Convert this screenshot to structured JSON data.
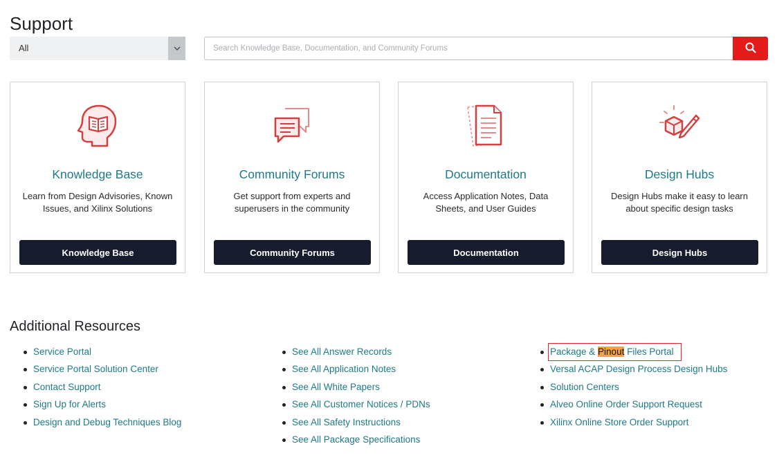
{
  "page": {
    "title": "Support"
  },
  "search": {
    "filter_value": "All",
    "placeholder": "Search Knowledge Base, Documentation, and Community Forums"
  },
  "cards": [
    {
      "icon": "head-book-icon",
      "title": "Knowledge Base",
      "description": "Learn from Design Advisories, Known Issues, and Xilinx Solutions",
      "button": "Knowledge Base"
    },
    {
      "icon": "chat-bubbles-icon",
      "title": "Community Forums",
      "description": "Get support from experts and superusers in the community",
      "button": "Community Forums"
    },
    {
      "icon": "document-icon",
      "title": "Documentation",
      "description": "Access Application Notes, Data Sheets, and User Guides",
      "button": "Documentation"
    },
    {
      "icon": "cube-pencil-icon",
      "title": "Design Hubs",
      "description": "Design Hubs make it easy to learn about specific design tasks",
      "button": "Design Hubs"
    }
  ],
  "additional_resources": {
    "title": "Additional Resources",
    "col1": [
      "Service Portal",
      "Service Portal Solution Center",
      "Contact Support",
      "Sign Up for Alerts",
      "Design and Debug Techniques Blog"
    ],
    "col2": [
      "See All Answer Records",
      "See All Application Notes",
      "See All White Papers",
      "See All Customer Notices / PDNs",
      "See All Safety Instructions",
      "See All Package Specifications"
    ],
    "col3_highlighted": {
      "before": "Package & ",
      "highlight": "Pinout",
      "after": " Files Portal"
    },
    "col3": [
      "Versal ACAP Design Process Design Hubs",
      "Solution Centers",
      "Alveo Online Order Support Request",
      "Xilinx Online Store Order Support"
    ]
  },
  "colors": {
    "accent_red": "#e31b1b",
    "link_teal": "#1e7a86",
    "button_dark": "#161b2e",
    "highlight_orange": "#f6a33b"
  }
}
